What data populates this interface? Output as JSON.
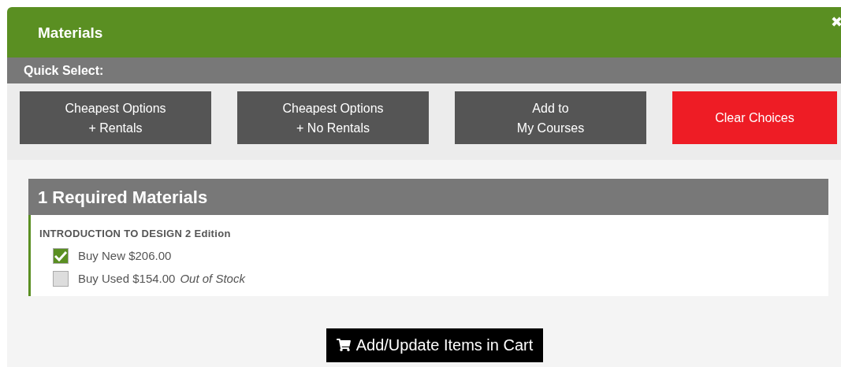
{
  "dialog": {
    "title": "Materials",
    "close": "✖"
  },
  "quick_select": {
    "label": "Quick Select:",
    "buttons": [
      {
        "lines": [
          "Cheapest Options",
          "+ Rentals"
        ],
        "kind": "default"
      },
      {
        "lines": [
          "Cheapest Options",
          "+ No Rentals"
        ],
        "kind": "default"
      },
      {
        "lines": [
          "Add to",
          "My Courses"
        ],
        "kind": "default"
      },
      {
        "lines": [
          "Clear Choices"
        ],
        "kind": "danger"
      }
    ]
  },
  "materials": {
    "heading": "1 Required Materials",
    "items": [
      {
        "title": "INTRODUCTION TO DESIGN 2 Edition",
        "options": [
          {
            "label": "Buy New $206.00",
            "checked": true
          },
          {
            "label": "Buy Used $154.00",
            "note": "Out of Stock",
            "checked": false
          }
        ]
      }
    ]
  },
  "cart_button": "Add/Update Items in Cart"
}
